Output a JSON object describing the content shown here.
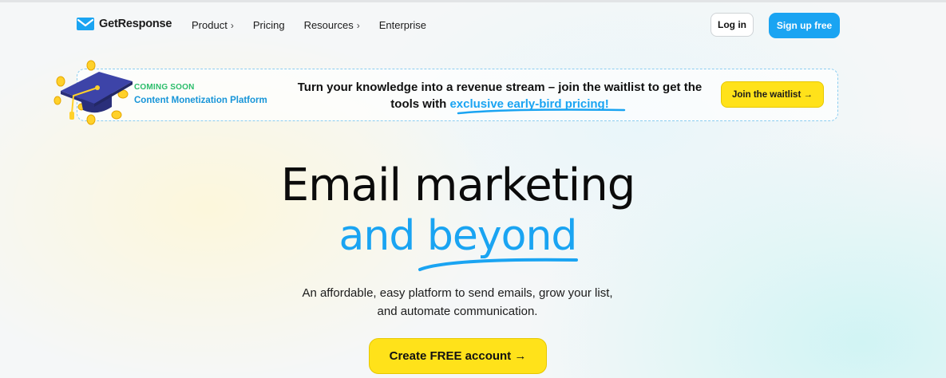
{
  "header": {
    "brand": "GetResponse",
    "nav": [
      {
        "label": "Product",
        "chevron": "›"
      },
      {
        "label": "Pricing",
        "chevron": ""
      },
      {
        "label": "Resources",
        "chevron": "›"
      },
      {
        "label": "Enterprise",
        "chevron": ""
      }
    ],
    "login_label": "Log in",
    "signup_label": "Sign up free"
  },
  "banner": {
    "badge": "COMING SOON",
    "product": "Content Monetization Platform",
    "text_before": "Turn your knowledge into a revenue stream – join the waitlist to get the tools with ",
    "text_highlight": "exclusive early-bird pricing!",
    "button_label": "Join the waitlist →"
  },
  "hero": {
    "line1": "Email marketing",
    "line2": "and beyond",
    "subtitle": "An affordable, easy platform to send emails, grow your list, and automate communication.",
    "cta_label": "Create FREE account →"
  },
  "colors": {
    "accent_blue": "#1aa4f2",
    "cta_yellow": "#ffe21a",
    "badge_green": "#2bbd6b"
  },
  "icons": {
    "logo": "envelope-logo-icon",
    "banner_art": "graduation-cap-coins-icon"
  }
}
